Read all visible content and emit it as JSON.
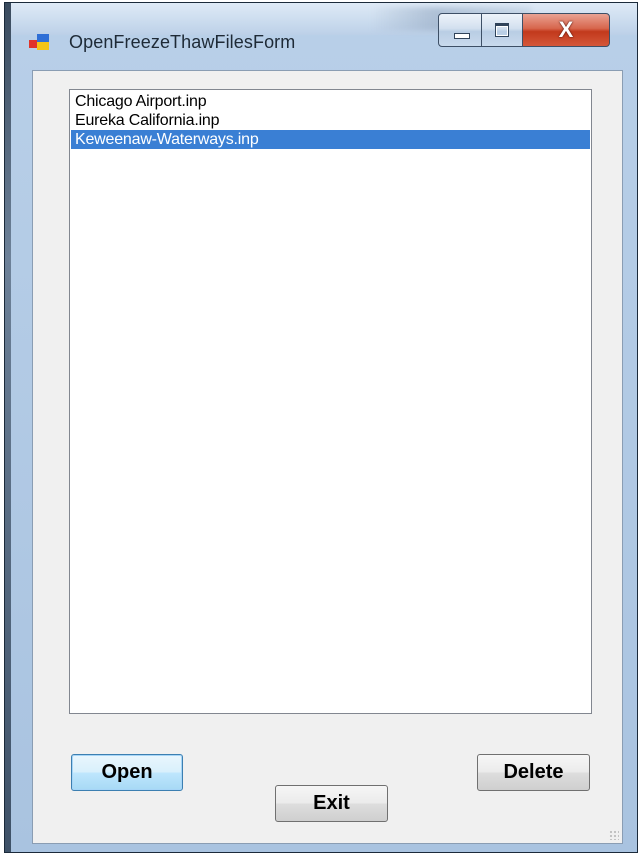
{
  "window": {
    "title": "OpenFreezeThawFilesForm",
    "close_glyph": "X",
    "icons": {
      "app": "windows-form-icon",
      "minimize": "minimize-icon",
      "maximize": "maximize-icon",
      "close": "close-icon"
    }
  },
  "file_list": {
    "items": [
      {
        "label": "Chicago Airport.inp",
        "selected": false
      },
      {
        "label": "Eureka California.inp",
        "selected": false
      },
      {
        "label": "Keweenaw-Waterways.inp",
        "selected": true
      }
    ]
  },
  "buttons": {
    "open": "Open",
    "delete": "Delete",
    "exit": "Exit"
  },
  "colors": {
    "selection": "#3a7fd4",
    "close_button": "#c2391c"
  }
}
